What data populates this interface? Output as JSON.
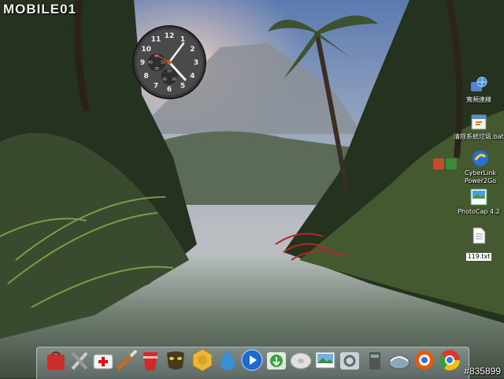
{
  "watermark": {
    "text": "MOBILE01"
  },
  "clock": {
    "face_numbers": [
      "12",
      "1",
      "2",
      "3",
      "4",
      "5",
      "6",
      "7",
      "8",
      "9",
      "10",
      "11"
    ],
    "sub_dial_left": [
      "60",
      "15",
      "30",
      "45"
    ],
    "sub_dial_bottom": [
      "10",
      "20",
      "30"
    ]
  },
  "desktop_icons": [
    {
      "label": "寬頻連線",
      "icon": "network-globe-icon"
    },
    {
      "label": "清除系統垃圾.bat",
      "icon": "batch-file-icon"
    },
    {
      "label": "CyberLink Power2Go",
      "icon": "power2go-icon"
    },
    {
      "label": "PhotoCap 4.2",
      "icon": "photocap-icon"
    },
    {
      "label": "119.txt",
      "icon": "text-file-icon"
    }
  ],
  "dock": {
    "items": [
      "red-bag-icon",
      "tools-icon",
      "first-aid-kit-icon",
      "paint-brush-icon",
      "red-cup-icon",
      "mask-icon",
      "gold-coin-icon",
      "water-drop-icon",
      "play-button-icon",
      "download-icon",
      "disk-icon",
      "photo-icon",
      "settings-icon",
      "trash-bin-icon",
      "globe-icon",
      "browser-icon",
      "chrome-icon"
    ]
  },
  "colors": {
    "accent_orange": "#e25b0d",
    "dock_tint": "#8c9aa0",
    "sky": "#7f96b8"
  },
  "image_id_text": "#835899"
}
